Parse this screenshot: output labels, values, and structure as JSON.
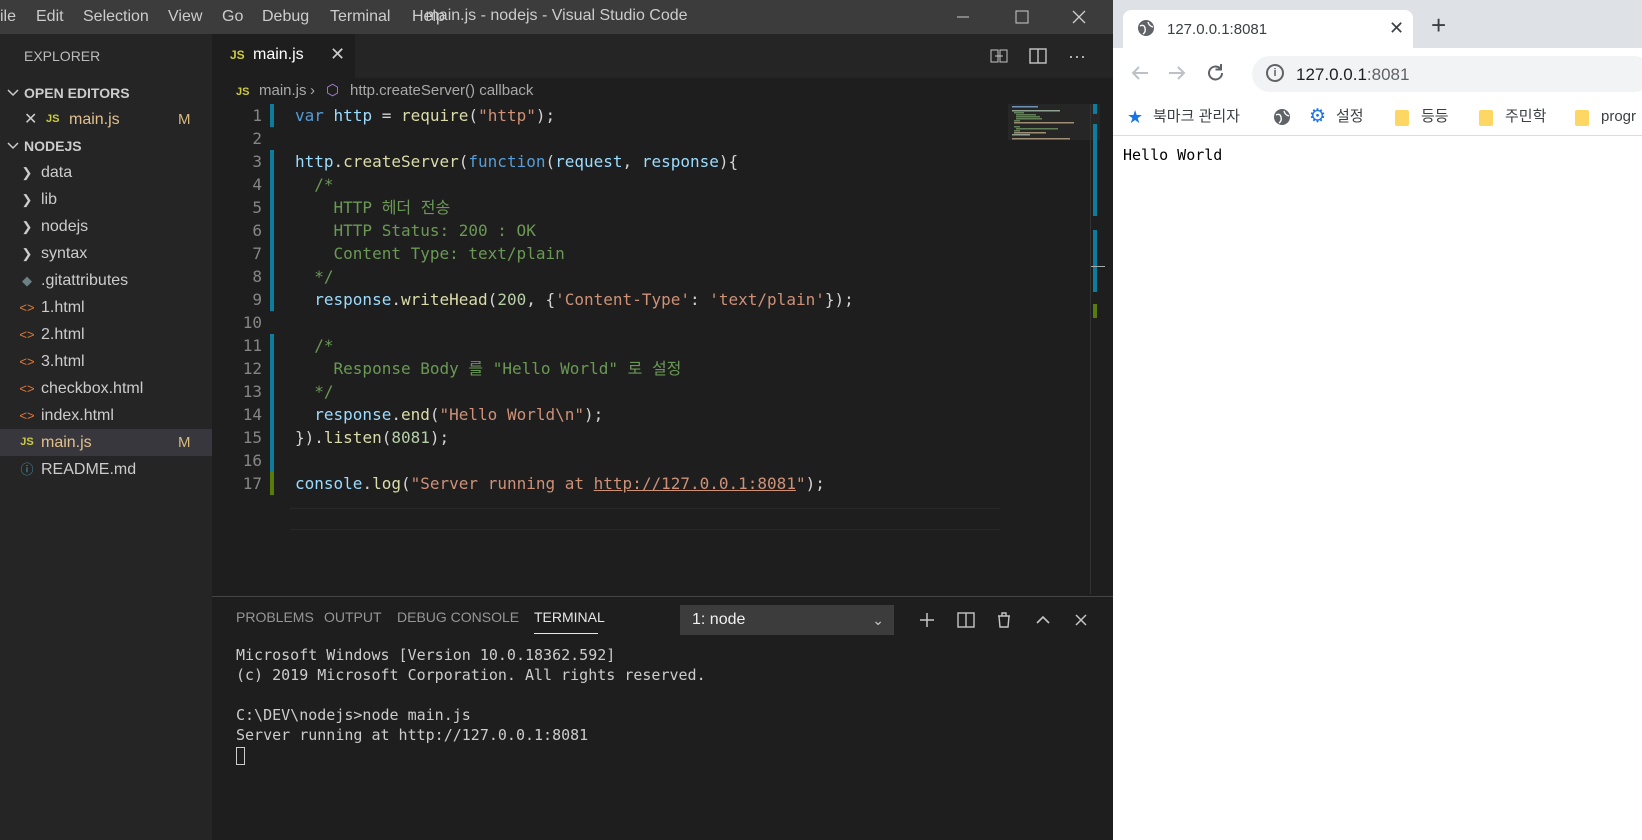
{
  "vscode": {
    "menu": [
      "ile",
      "Edit",
      "Selection",
      "View",
      "Go",
      "Debug",
      "Terminal",
      "Help"
    ],
    "title": "main.js - nodejs - Visual Studio Code",
    "explorer_title": "EXPLORER",
    "open_editors_title": "OPEN EDITORS",
    "open_editor": {
      "icon": "JS",
      "name": "main.js",
      "status": "M"
    },
    "folder_title": "NODEJS",
    "tree": [
      {
        "name": "data",
        "icon": "chevron-right"
      },
      {
        "name": "lib",
        "icon": "chevron-right"
      },
      {
        "name": "nodejs",
        "icon": "chevron-right"
      },
      {
        "name": "syntax",
        "icon": "chevron-right"
      },
      {
        "name": ".gitattributes",
        "icon": "git-icon"
      },
      {
        "name": "1.html",
        "icon": "html-icon"
      },
      {
        "name": "2.html",
        "icon": "html-icon"
      },
      {
        "name": "3.html",
        "icon": "html-icon"
      },
      {
        "name": "checkbox.html",
        "icon": "html-icon"
      },
      {
        "name": "index.html",
        "icon": "html-icon"
      },
      {
        "name": "main.js",
        "icon": "js-icon",
        "status": "M",
        "selected": true
      },
      {
        "name": "README.md",
        "icon": "info-icon"
      }
    ],
    "tab": {
      "icon": "JS",
      "name": "main.js"
    },
    "breadcrumb": {
      "icon": "JS",
      "file": "main.js",
      "symbol": "http.createServer() callback"
    },
    "line_numbers": [
      "1",
      "2",
      "3",
      "4",
      "5",
      "6",
      "7",
      "8",
      "9",
      "10",
      "11",
      "12",
      "13",
      "14",
      "15",
      "16",
      "17"
    ],
    "code_lines": [
      "var http = require(\"http\");",
      "",
      "http.createServer(function(request, response){",
      "  /*",
      "    HTTP 헤더 전송",
      "    HTTP Status: 200 : OK",
      "    Content Type: text/plain",
      "  */",
      "  response.writeHead(200, {'Content-Type': 'text/plain'});",
      "",
      "  /*",
      "    Response Body 를 \"Hello World\" 로 설정",
      "  */",
      "  response.end(\"Hello World\\n\");",
      "}).listen(8081);",
      "",
      "console.log(\"Server running at http://127.0.0.1:8081\");"
    ],
    "panel": {
      "tabs": [
        "PROBLEMS",
        "OUTPUT",
        "DEBUG CONSOLE",
        "TERMINAL"
      ],
      "active_tab": "TERMINAL",
      "terminal_select": "1: node",
      "terminal_lines": [
        "Microsoft Windows [Version 10.0.18362.592]",
        "(c) 2019 Microsoft Corporation. All rights reserved.",
        "",
        "C:\\DEV\\nodejs>node main.js",
        "Server running at http://127.0.0.1:8081"
      ]
    }
  },
  "chrome": {
    "tab_title": "127.0.0.1:8081",
    "url_host": "127.0.0.1",
    "url_port": ":8081",
    "bookmarks": [
      "북마크 관리자",
      "설정",
      "등등",
      "주민학",
      "progr"
    ],
    "page_text": "Hello World"
  },
  "colors": {
    "keyword": "#569cd6",
    "variable": "#9cdcfe",
    "function": "#dcdcaa",
    "string": "#ce9178",
    "number": "#b5cea8",
    "comment": "#6a9955",
    "modified": "#d7ba7d",
    "js_icon": "#cbcb41",
    "html_icon": "#e37933",
    "info_icon": "#519aba"
  }
}
